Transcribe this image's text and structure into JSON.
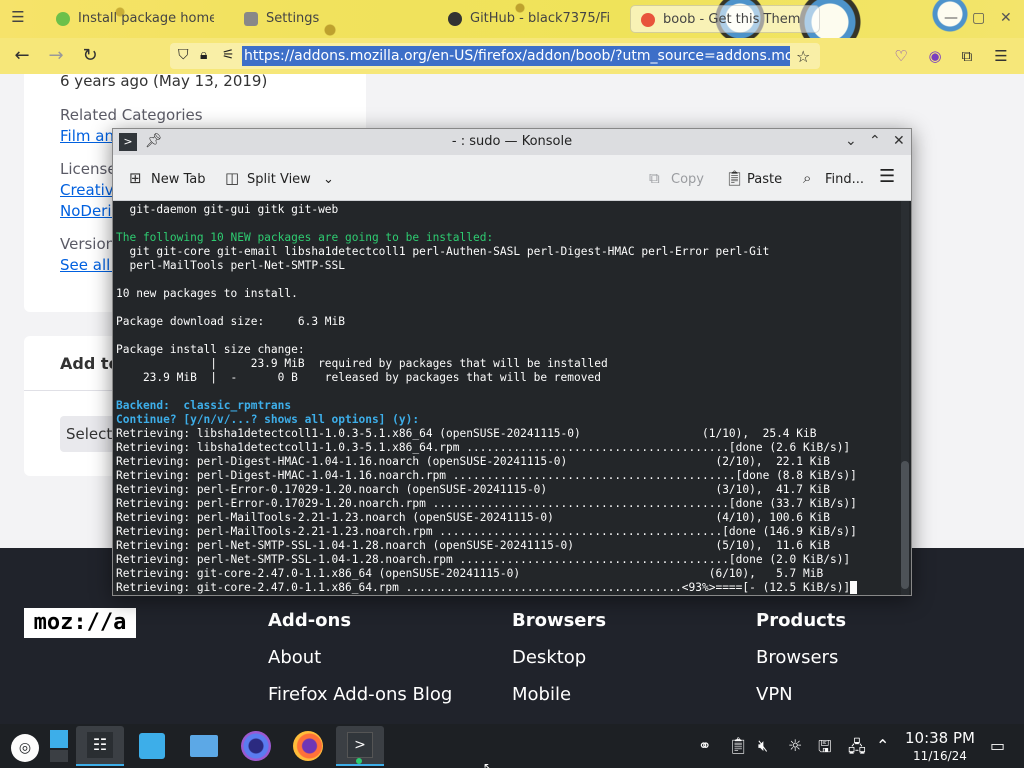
{
  "browser": {
    "tabs": [
      {
        "label": "Install package home"
      },
      {
        "label": "Settings"
      },
      {
        "label": "GitHub - black7375/Fi"
      },
      {
        "label": "boob - Get this Them"
      }
    ],
    "url": "https://addons.mozilla.org/en-US/firefox/addon/boob/?utm_source=addons.mozill"
  },
  "page": {
    "date_text": "6 years ago (May 13, 2019)",
    "related_categories_label": "Related Categories",
    "category_link": "Film and",
    "license_label": "License",
    "license_link1": "Creative",
    "license_link2": "NoDeriv",
    "version_label": "Version",
    "version_link": "See all v",
    "add_to_label": "Add to",
    "select_label": "Select"
  },
  "footer": {
    "logo": "moz://a",
    "col1": {
      "head": "Add-ons",
      "links": [
        "About",
        "Firefox Add-ons Blog"
      ]
    },
    "col2": {
      "head": "Browsers",
      "links": [
        "Desktop",
        "Mobile"
      ]
    },
    "col3": {
      "head": "Products",
      "links": [
        "Browsers",
        "VPN"
      ]
    }
  },
  "konsole": {
    "title": "- : sudo — Konsole",
    "toolbar": {
      "new_tab": "New Tab",
      "split_view": "Split View",
      "copy": "Copy",
      "paste": "Paste",
      "find": "Find..."
    },
    "lines": [
      {
        "text": "  git-daemon git-gui gitk git-web",
        "cls": ""
      },
      {
        "text": "",
        "cls": ""
      },
      {
        "text": "The following 10 NEW packages are going to be installed:",
        "cls": "g"
      },
      {
        "text": "  git git-core git-email libsha1detectcoll1 perl-Authen-SASL perl-Digest-HMAC perl-Error perl-Git",
        "cls": ""
      },
      {
        "text": "  perl-MailTools perl-Net-SMTP-SSL",
        "cls": ""
      },
      {
        "text": "",
        "cls": ""
      },
      {
        "text": "10 new packages to install.",
        "cls": ""
      },
      {
        "text": "",
        "cls": ""
      },
      {
        "text": "Package download size:     6.3 MiB",
        "cls": ""
      },
      {
        "text": "",
        "cls": ""
      },
      {
        "text": "Package install size change:",
        "cls": ""
      },
      {
        "text": "              |     23.9 MiB  required by packages that will be installed",
        "cls": ""
      },
      {
        "text": "    23.9 MiB  |  -      0 B    released by packages that will be removed",
        "cls": ""
      },
      {
        "text": "",
        "cls": ""
      },
      {
        "text": "Backend:  classic_rpmtrans",
        "cls": "b"
      },
      {
        "text": "Continue? [y/n/v/...? shows all options] (y):",
        "cls": "b"
      },
      {
        "text": "Retrieving: libsha1detectcoll1-1.0.3-5.1.x86_64 (openSUSE-20241115-0)                  (1/10),  25.4 KiB",
        "cls": ""
      },
      {
        "text": "Retrieving: libsha1detectcoll1-1.0.3-5.1.x86_64.rpm .......................................[done (2.6 KiB/s)]",
        "cls": ""
      },
      {
        "text": "Retrieving: perl-Digest-HMAC-1.04-1.16.noarch (openSUSE-20241115-0)                      (2/10),  22.1 KiB",
        "cls": ""
      },
      {
        "text": "Retrieving: perl-Digest-HMAC-1.04-1.16.noarch.rpm ..........................................[done (8.8 KiB/s)]",
        "cls": ""
      },
      {
        "text": "Retrieving: perl-Error-0.17029-1.20.noarch (openSUSE-20241115-0)                         (3/10),  41.7 KiB",
        "cls": ""
      },
      {
        "text": "Retrieving: perl-Error-0.17029-1.20.noarch.rpm ............................................[done (33.7 KiB/s)]",
        "cls": ""
      },
      {
        "text": "Retrieving: perl-MailTools-2.21-1.23.noarch (openSUSE-20241115-0)                        (4/10), 100.6 KiB",
        "cls": ""
      },
      {
        "text": "Retrieving: perl-MailTools-2.21-1.23.noarch.rpm ..........................................[done (146.9 KiB/s)]",
        "cls": ""
      },
      {
        "text": "Retrieving: perl-Net-SMTP-SSL-1.04-1.28.noarch (openSUSE-20241115-0)                     (5/10),  11.6 KiB",
        "cls": ""
      },
      {
        "text": "Retrieving: perl-Net-SMTP-SSL-1.04-1.28.noarch.rpm ........................................[done (2.0 KiB/s)]",
        "cls": ""
      },
      {
        "text": "Retrieving: git-core-2.47.0-1.1.x86_64 (openSUSE-20241115-0)                            (6/10),   5.7 MiB",
        "cls": ""
      },
      {
        "text": "Retrieving: git-core-2.47.0-1.1.x86_64.rpm .........................................<93%>====[- (12.5 KiB/s)]",
        "cls": ""
      }
    ]
  },
  "taskbar": {
    "time": "10:38 PM",
    "date": "11/16/24"
  }
}
